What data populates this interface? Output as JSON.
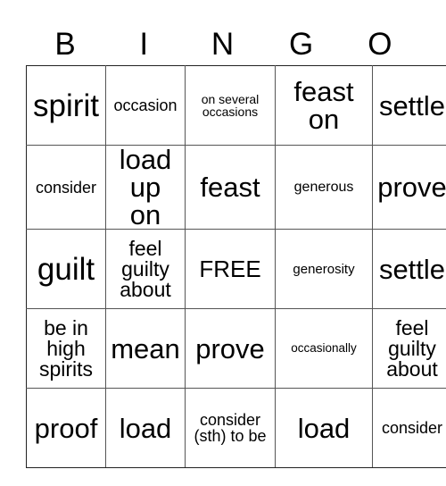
{
  "header": [
    "B",
    "I",
    "N",
    "G",
    "O"
  ],
  "rows": [
    [
      "spirit",
      "occasion",
      "on several occasions",
      "feast on",
      "settle"
    ],
    [
      "consider",
      "load up on",
      "feast",
      "generous",
      "prove"
    ],
    [
      "guilt",
      "feel guilty about",
      "FREE",
      "generosity",
      "settle"
    ],
    [
      "be in high spirits",
      "mean",
      "prove",
      "occasionally",
      "feel guilty about"
    ],
    [
      "proof",
      "load",
      "consider (sth) to be",
      "load",
      "consider"
    ]
  ]
}
